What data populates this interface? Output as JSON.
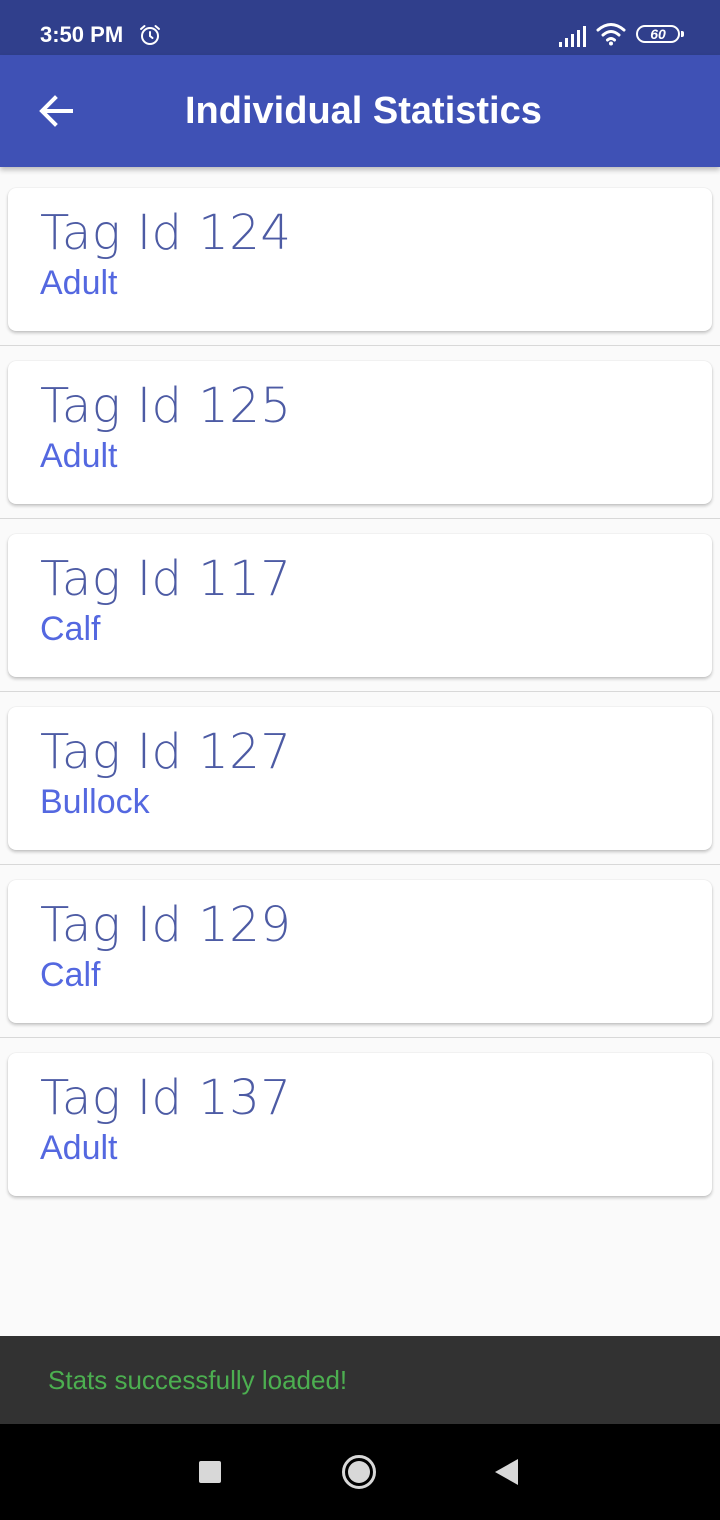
{
  "status_bar": {
    "time": "3:50 PM",
    "battery": "60",
    "icons": [
      "alarm-icon",
      "signal-icon",
      "wifi-icon",
      "battery-icon"
    ]
  },
  "app_bar": {
    "title": "Individual Statistics",
    "back_icon": "arrow-back-icon"
  },
  "list": {
    "items": [
      {
        "title": "Tag Id 124",
        "category": "Adult"
      },
      {
        "title": "Tag Id 125",
        "category": "Adult"
      },
      {
        "title": "Tag Id 117",
        "category": "Calf"
      },
      {
        "title": "Tag Id 127",
        "category": "Bullock"
      },
      {
        "title": "Tag Id 129",
        "category": "Calf"
      },
      {
        "title": "Tag Id 137",
        "category": "Adult"
      }
    ]
  },
  "snackbar": {
    "message": "Stats successfully loaded!"
  },
  "nav_bar": {
    "icons": [
      "recents-square-icon",
      "home-circle-icon",
      "back-triangle-icon"
    ]
  },
  "colors": {
    "status_bar": "#303f8c",
    "app_bar": "#3f51b5",
    "title_text": "#3a4a9b",
    "category_text": "#5468e0",
    "snackbar_bg": "#323232",
    "snackbar_text": "#4caf50"
  }
}
